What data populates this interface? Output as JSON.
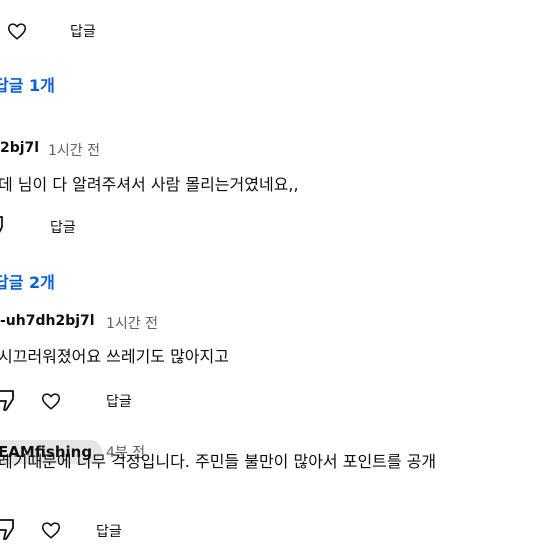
{
  "actions": {
    "reply_label": "답글"
  },
  "blocks": [
    {
      "reply_count": "답글 1개"
    },
    {
      "author": "2bj7l",
      "time": "1시간 전",
      "text": "데 님이 다 알려주셔서 사람 몰리는거였네요,,",
      "reply_count": "답글 2개"
    },
    {
      "author": "-uh7dh2bj7l",
      "time": "1시간 전",
      "text": "시끄러워졌어요 쓰레기도 많아지고"
    },
    {
      "author": "EAMfishing",
      "time": "4분 전",
      "text": "레기때문에 너무 걱정입니다. 주민들 불만이 많아서 포인트를 공개"
    }
  ]
}
